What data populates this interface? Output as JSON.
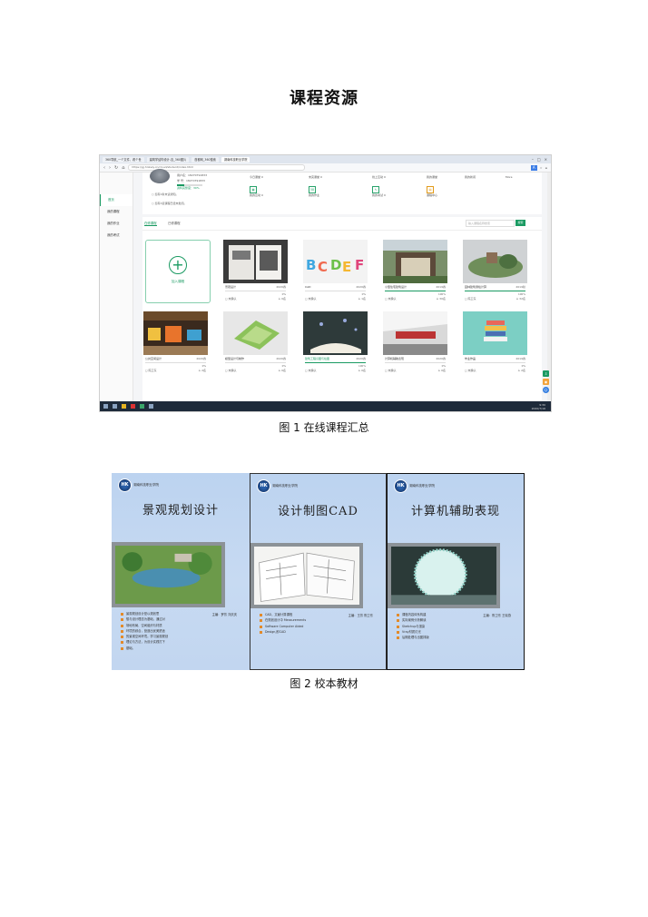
{
  "document": {
    "title": "课程资源",
    "figure1_caption": "图 1  在线课程汇总",
    "figure2_caption": "图 2  校本教材"
  },
  "browser": {
    "tabs": [
      "360导航_一个文件、看个世",
      "建筑学结构设计-百_360图片",
      "首都网_360搜索",
      "湖南科技职业学院"
    ],
    "active_tab": 3,
    "url": "https://gj.hnkszy.cn/cloud/student/index.html",
    "badge": "A"
  },
  "sidebar": {
    "items": [
      "首页",
      "我的课程",
      "我的作业",
      "我的考试"
    ],
    "active": 0
  },
  "user_panel": {
    "line1": "用户名：18270791833",
    "line2": "学  号：18270791833",
    "progress_label": "资料完整度：30%",
    "progress_value": 0.3,
    "check1": "您有0条未读通知。",
    "check2": "您有0道课程已经未批阅。",
    "stats": [
      {
        "label": "今日课堂",
        "num": "0"
      },
      {
        "label": "未完课堂",
        "num": "0"
      },
      {
        "label": "线上互动",
        "num": "0"
      },
      {
        "label": "我的课堂",
        "num": "0"
      },
      {
        "label": "我的互动",
        "num": "0"
      },
      {
        "label": "我的作业",
        "num": "58"
      },
      {
        "label": "我的考试",
        "num": "0"
      },
      {
        "label": "课程中心",
        "num": "0"
      }
    ],
    "right_labels": [
      "我的课堂",
      "我的新闻",
      "More"
    ]
  },
  "course_tabs": {
    "tab1": "在修课程",
    "tab2": "已修课程",
    "search_placeholder": "输入课程名称搜索",
    "search_button": "搜索",
    "add_label": "加入课程"
  },
  "courses": [
    {
      "name": "景观设计",
      "year": "2020春",
      "pct": "0%",
      "progress": 0.0,
      "teacher": "未确认",
      "students": "0名"
    },
    {
      "name": "CAD",
      "year": "2020春",
      "pct": "0%",
      "progress": 0.0,
      "teacher": "未确认",
      "students": "1名"
    },
    {
      "name": "小型住宅建筑设计",
      "year": "2019春",
      "pct": "100%",
      "progress": 1.0,
      "teacher": "未确认",
      "students": "30名"
    },
    {
      "name": "园林建筑测绘计算",
      "year": "2019秋",
      "pct": "100%",
      "progress": 1.0,
      "teacher": "陈卫东",
      "students": "32名"
    },
    {
      "name": "公共空间设计",
      "year": "2020春",
      "pct": "0%",
      "progress": 0.0,
      "teacher": "陈卫东",
      "students": "2名"
    },
    {
      "name": "模型设计与制作",
      "year": "2020春",
      "pct": "0%",
      "progress": 0.0,
      "teacher": "未确认",
      "students": "0名"
    },
    {
      "name": "建筑工程识图与绘图",
      "year": "2020春",
      "pct": "100%",
      "progress": 1.0,
      "teacher": "未确认",
      "students": "0名"
    },
    {
      "name": "计算机辅助表现",
      "year": "2020春",
      "pct": "0%",
      "progress": 0.0,
      "teacher": "未确认",
      "students": "0名"
    },
    {
      "name": "毕业作品",
      "year": "2019春",
      "pct": "0%",
      "progress": 0.0,
      "teacher": "未确认",
      "students": "2名"
    }
  ],
  "taskbar": {
    "time": "9:30",
    "date": "2020/7/16"
  },
  "books": [
    {
      "school": "湖南科技职业学院",
      "title": "景观规划设计",
      "author": "主编：罗芳  刘庆庆",
      "bullets": [
        "景观规划设计是以规划思",
        "想与设计理念为基础，通过对",
        "场地布局、空间组织与材质",
        "环境的综合，营造出优美舒适",
        "的景观空间环境。学习景观规划",
        "理论与方法，为设计实践打下",
        "基础。"
      ]
    },
    {
      "school": "湖南科技职业学院",
      "title": "设计制图CAD",
      "author": "主编：王芳  陈卫东",
      "bullets": [
        "CAD，文献计算课程",
        "在规划设计中 Measurements",
        "Software Computer Aided",
        "Design,即CAD"
      ]
    },
    {
      "school": "湖南科技职业学院",
      "title": "计算机辅助表现",
      "author": "主编：陈卫东  王晓燕",
      "bullets": [
        "课程内容体系构建",
        "实际案例分析解读",
        "Sketchup与渲染",
        "Vray材质灯光",
        "后期处理与出图排版"
      ]
    }
  ]
}
